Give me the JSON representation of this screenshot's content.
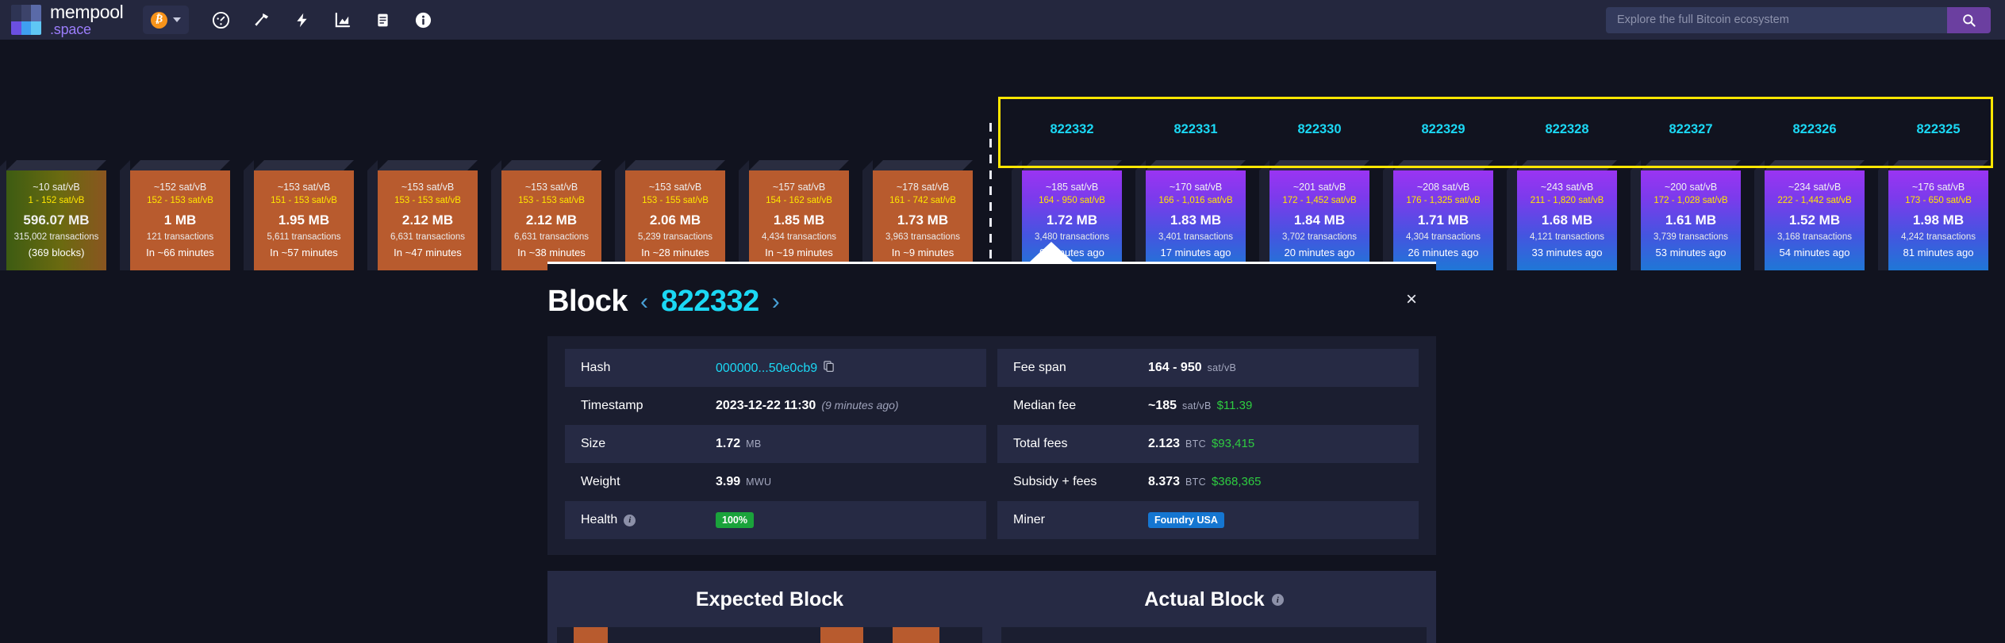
{
  "header": {
    "logo_line1": "mempool",
    "logo_line2": ".space",
    "network_symbol": "₿",
    "nav_icons": [
      "dashboard-icon",
      "mining-icon",
      "lightning-icon",
      "graphs-icon",
      "docs-icon",
      "about-icon"
    ],
    "search": {
      "placeholder": "Explore the full Bitcoin ecosystem",
      "value": "",
      "button_icon": "search-icon"
    }
  },
  "mempool_blocks": [
    {
      "fee_median": "~10 sat/vB",
      "fee_span": "1 - 152 sat/vB",
      "size": "596.07 MB",
      "txs": "315,002 transactions",
      "eta": "(369 blocks)"
    },
    {
      "fee_median": "~152 sat/vB",
      "fee_span": "152 - 153 sat/vB",
      "size": "1 MB",
      "txs": "121 transactions",
      "eta": "In ~66 minutes"
    },
    {
      "fee_median": "~153 sat/vB",
      "fee_span": "151 - 153 sat/vB",
      "size": "1.95 MB",
      "txs": "5,611 transactions",
      "eta": "In ~57 minutes"
    },
    {
      "fee_median": "~153 sat/vB",
      "fee_span": "153 - 153 sat/vB",
      "size": "2.12 MB",
      "txs": "6,631 transactions",
      "eta": "In ~47 minutes"
    },
    {
      "fee_median": "~153 sat/vB",
      "fee_span": "153 - 153 sat/vB",
      "size": "2.12 MB",
      "txs": "6,631 transactions",
      "eta": "In ~38 minutes"
    },
    {
      "fee_median": "~153 sat/vB",
      "fee_span": "153 - 155 sat/vB",
      "size": "2.06 MB",
      "txs": "5,239 transactions",
      "eta": "In ~28 minutes"
    },
    {
      "fee_median": "~157 sat/vB",
      "fee_span": "154 - 162 sat/vB",
      "size": "1.85 MB",
      "txs": "4,434 transactions",
      "eta": "In ~19 minutes"
    },
    {
      "fee_median": "~178 sat/vB",
      "fee_span": "161 - 742 sat/vB",
      "size": "1.73 MB",
      "txs": "3,963 transactions",
      "eta": "In ~9 minutes"
    }
  ],
  "mined_blocks": [
    {
      "height": "822332",
      "fee_median": "~185 sat/vB",
      "fee_span": "164 - 950 sat/vB",
      "size": "1.72 MB",
      "txs": "3,480 transactions",
      "age": "9 minutes ago"
    },
    {
      "height": "822331",
      "fee_median": "~170 sat/vB",
      "fee_span": "166 - 1,016 sat/vB",
      "size": "1.83 MB",
      "txs": "3,401 transactions",
      "age": "17 minutes ago"
    },
    {
      "height": "822330",
      "fee_median": "~201 sat/vB",
      "fee_span": "172 - 1,452 sat/vB",
      "size": "1.84 MB",
      "txs": "3,702 transactions",
      "age": "20 minutes ago"
    },
    {
      "height": "822329",
      "fee_median": "~208 sat/vB",
      "fee_span": "176 - 1,325 sat/vB",
      "size": "1.71 MB",
      "txs": "4,304 transactions",
      "age": "26 minutes ago"
    },
    {
      "height": "822328",
      "fee_median": "~243 sat/vB",
      "fee_span": "211 - 1,820 sat/vB",
      "size": "1.68 MB",
      "txs": "4,121 transactions",
      "age": "33 minutes ago"
    },
    {
      "height": "822327",
      "fee_median": "~200 sat/vB",
      "fee_span": "172 - 1,028 sat/vB",
      "size": "1.61 MB",
      "txs": "3,739 transactions",
      "age": "53 minutes ago"
    },
    {
      "height": "822326",
      "fee_median": "~234 sat/vB",
      "fee_span": "222 - 1,442 sat/vB",
      "size": "1.52 MB",
      "txs": "3,168 transactions",
      "age": "54 minutes ago"
    },
    {
      "height": "822325",
      "fee_median": "~176 sat/vB",
      "fee_span": "173 - 650 sat/vB",
      "size": "1.98 MB",
      "txs": "4,242 transactions",
      "age": "81 minutes ago"
    }
  ],
  "panel": {
    "title": "Block",
    "prev_arrow": "‹",
    "next_arrow": "›",
    "block_number": "822332",
    "close_label": "×",
    "left_rows": [
      {
        "label": "Hash",
        "value": "000000...50e0cb9",
        "unit": "",
        "fiat": "",
        "note": "",
        "kind": "link-copy"
      },
      {
        "label": "Timestamp",
        "value": "2023-12-22 11:30",
        "unit": "",
        "fiat": "",
        "note": "(9 minutes ago)",
        "kind": "text"
      },
      {
        "label": "Size",
        "value": "1.72",
        "unit": "MB",
        "fiat": "",
        "note": "",
        "kind": "text"
      },
      {
        "label": "Weight",
        "value": "3.99",
        "unit": "MWU",
        "fiat": "",
        "note": "",
        "kind": "text"
      },
      {
        "label": "Health",
        "value": "100%",
        "unit": "",
        "fiat": "",
        "note": "",
        "kind": "badge-green"
      }
    ],
    "right_rows": [
      {
        "label": "Fee span",
        "value": "164 - 950",
        "unit": "sat/vB",
        "fiat": "",
        "kind": "text"
      },
      {
        "label": "Median fee",
        "value": "~185",
        "unit": "sat/vB",
        "fiat": "$11.39",
        "kind": "text"
      },
      {
        "label": "Total fees",
        "value": "2.123",
        "unit": "BTC",
        "fiat": "$93,415",
        "kind": "text"
      },
      {
        "label": "Subsidy + fees",
        "value": "8.373",
        "unit": "BTC",
        "fiat": "$368,365",
        "kind": "text"
      },
      {
        "label": "Miner",
        "value": "Foundry USA",
        "unit": "",
        "fiat": "",
        "kind": "badge-blue"
      }
    ]
  },
  "compare": {
    "expected_label": "Expected Block",
    "actual_label": "Actual Block"
  },
  "colors": {
    "accent_cyan": "#1bd8f4",
    "highlight_yellow": "#ffe600",
    "mempool_block": "#b85b2e",
    "mined_block_top": "#8e3df0",
    "mined_block_bottom": "#1f77d6",
    "green": "#2ecc40",
    "purple_btn": "#6b3fa0"
  }
}
